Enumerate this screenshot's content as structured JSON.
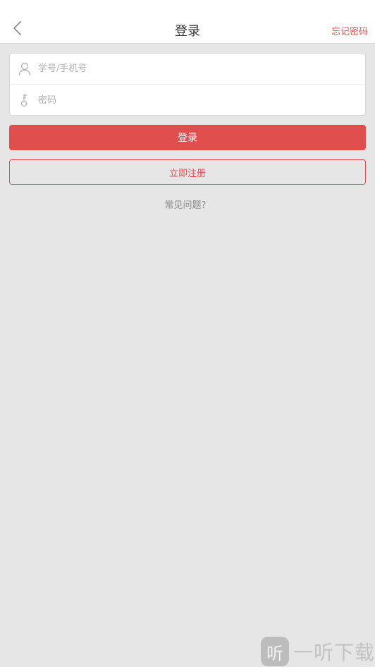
{
  "header": {
    "title": "登录",
    "forgot_password": "忘记密码",
    "back_icon": "chevron-left-icon"
  },
  "form": {
    "account_placeholder": "学号/手机号",
    "account_value": "",
    "account_icon": "user-icon",
    "password_placeholder": "密码",
    "password_value": "",
    "password_icon": "key-icon"
  },
  "actions": {
    "login_label": "登录",
    "register_label": "立即注册",
    "faq_label": "常见问题？"
  },
  "watermark": {
    "badge": "听",
    "text": "一听下载"
  },
  "colors": {
    "accent": "#e04e4e",
    "background": "#e6e6e6",
    "header_bg": "#ffffff"
  }
}
